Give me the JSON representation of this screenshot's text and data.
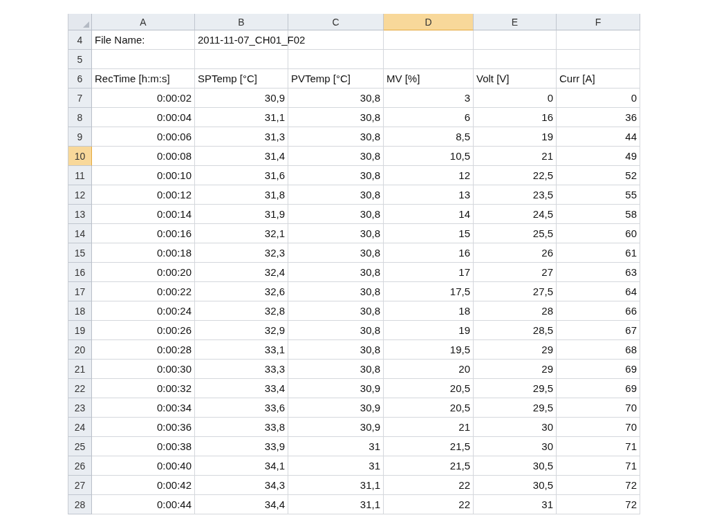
{
  "columns": [
    {
      "label": "A",
      "selected": false
    },
    {
      "label": "B",
      "selected": false
    },
    {
      "label": "C",
      "selected": false
    },
    {
      "label": "D",
      "selected": true
    },
    {
      "label": "E",
      "selected": false
    },
    {
      "label": "F",
      "selected": false
    }
  ],
  "rows": [
    {
      "number": "4",
      "selected": false,
      "kind": "text",
      "cells": [
        "File Name:",
        "2011-11-07_CH01_F02"
      ]
    },
    {
      "number": "5",
      "selected": false,
      "kind": "text"
    },
    {
      "number": "6",
      "selected": false,
      "kind": "text",
      "cells": [
        "RecTime [h:m:s]",
        "SPTemp [°C]",
        "PVTemp [°C]",
        "MV [%]",
        "Volt [V]",
        "Curr [A]"
      ]
    },
    {
      "number": "7",
      "selected": false,
      "kind": "number",
      "cells": [
        "0:00:02",
        "30,9",
        "30,8",
        "3",
        "0",
        "0"
      ]
    },
    {
      "number": "8",
      "selected": false,
      "kind": "number",
      "cells": [
        "0:00:04",
        "31,1",
        "30,8",
        "6",
        "16",
        "36"
      ]
    },
    {
      "number": "9",
      "selected": false,
      "kind": "number",
      "cells": [
        "0:00:06",
        "31,3",
        "30,8",
        "8,5",
        "19",
        "44"
      ]
    },
    {
      "number": "10",
      "selected": true,
      "kind": "number",
      "cells": [
        "0:00:08",
        "31,4",
        "30,8",
        "10,5",
        "21",
        "49"
      ]
    },
    {
      "number": "11",
      "selected": false,
      "kind": "number",
      "cells": [
        "0:00:10",
        "31,6",
        "30,8",
        "12",
        "22,5",
        "52"
      ]
    },
    {
      "number": "12",
      "selected": false,
      "kind": "number",
      "cells": [
        "0:00:12",
        "31,8",
        "30,8",
        "13",
        "23,5",
        "55"
      ]
    },
    {
      "number": "13",
      "selected": false,
      "kind": "number",
      "cells": [
        "0:00:14",
        "31,9",
        "30,8",
        "14",
        "24,5",
        "58"
      ]
    },
    {
      "number": "14",
      "selected": false,
      "kind": "number",
      "cells": [
        "0:00:16",
        "32,1",
        "30,8",
        "15",
        "25,5",
        "60"
      ]
    },
    {
      "number": "15",
      "selected": false,
      "kind": "number",
      "cells": [
        "0:00:18",
        "32,3",
        "30,8",
        "16",
        "26",
        "61"
      ]
    },
    {
      "number": "16",
      "selected": false,
      "kind": "number",
      "cells": [
        "0:00:20",
        "32,4",
        "30,8",
        "17",
        "27",
        "63"
      ]
    },
    {
      "number": "17",
      "selected": false,
      "kind": "number",
      "cells": [
        "0:00:22",
        "32,6",
        "30,8",
        "17,5",
        "27,5",
        "64"
      ]
    },
    {
      "number": "18",
      "selected": false,
      "kind": "number",
      "cells": [
        "0:00:24",
        "32,8",
        "30,8",
        "18",
        "28",
        "66"
      ]
    },
    {
      "number": "19",
      "selected": false,
      "kind": "number",
      "cells": [
        "0:00:26",
        "32,9",
        "30,8",
        "19",
        "28,5",
        "67"
      ]
    },
    {
      "number": "20",
      "selected": false,
      "kind": "number",
      "cells": [
        "0:00:28",
        "33,1",
        "30,8",
        "19,5",
        "29",
        "68"
      ]
    },
    {
      "number": "21",
      "selected": false,
      "kind": "number",
      "cells": [
        "0:00:30",
        "33,3",
        "30,8",
        "20",
        "29",
        "69"
      ]
    },
    {
      "number": "22",
      "selected": false,
      "kind": "number",
      "cells": [
        "0:00:32",
        "33,4",
        "30,9",
        "20,5",
        "29,5",
        "69"
      ]
    },
    {
      "number": "23",
      "selected": false,
      "kind": "number",
      "cells": [
        "0:00:34",
        "33,6",
        "30,9",
        "20,5",
        "29,5",
        "70"
      ]
    },
    {
      "number": "24",
      "selected": false,
      "kind": "number",
      "cells": [
        "0:00:36",
        "33,8",
        "30,9",
        "21",
        "30",
        "70"
      ]
    },
    {
      "number": "25",
      "selected": false,
      "kind": "number",
      "cells": [
        "0:00:38",
        "33,9",
        "31",
        "21,5",
        "30",
        "71"
      ]
    },
    {
      "number": "26",
      "selected": false,
      "kind": "number",
      "cells": [
        "0:00:40",
        "34,1",
        "31",
        "21,5",
        "30,5",
        "71"
      ]
    },
    {
      "number": "27",
      "selected": false,
      "kind": "number",
      "cells": [
        "0:00:42",
        "34,3",
        "31,1",
        "22",
        "30,5",
        "72"
      ]
    },
    {
      "number": "28",
      "selected": false,
      "kind": "number",
      "cells": [
        "0:00:44",
        "34,4",
        "31,1",
        "22",
        "31",
        "72"
      ]
    }
  ]
}
